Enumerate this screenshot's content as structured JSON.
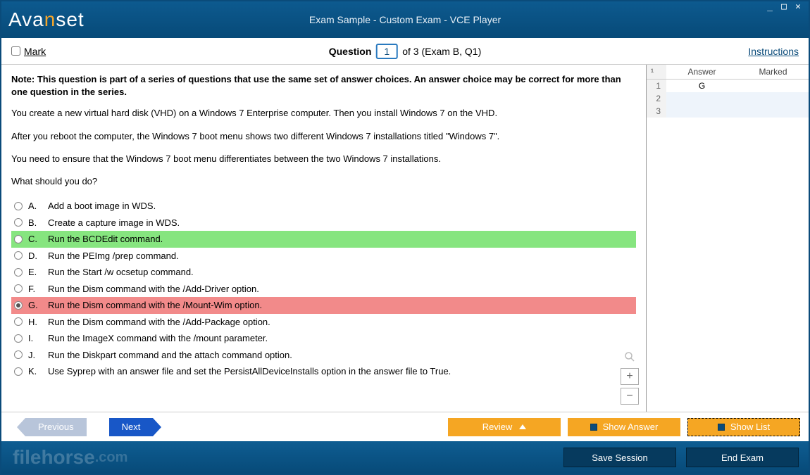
{
  "header": {
    "logo_pre": "Ava",
    "logo_n": "n",
    "logo_post": "set",
    "title": "Exam Sample - Custom Exam - VCE Player"
  },
  "qbar": {
    "mark_label": "Mark",
    "question_label": "Question",
    "number": "1",
    "of_text": "of 3 (Exam B, Q1)",
    "instructions": "Instructions"
  },
  "question": {
    "note": "Note: This question is part of a series of questions that use the same set of answer choices. An answer choice may be correct for more than one question in the series.",
    "p1": "You create a new virtual hard disk (VHD) on a Windows 7 Enterprise computer. Then you install Windows 7 on the VHD.",
    "p2": "After you reboot the computer, the Windows 7 boot menu shows two different Windows 7 installations titled \"Windows 7\".",
    "p3": "You need to ensure that the Windows 7 boot menu differentiates between the two Windows 7 installations.",
    "p4": "What should you do?",
    "choices": [
      {
        "l": "A.",
        "t": "Add a boot image in WDS."
      },
      {
        "l": "B.",
        "t": "Create a capture image in WDS."
      },
      {
        "l": "C.",
        "t": "Run the BCDEdit command."
      },
      {
        "l": "D.",
        "t": "Run the PEImg /prep command."
      },
      {
        "l": "E.",
        "t": "Run the Start /w ocsetup command."
      },
      {
        "l": "F.",
        "t": "Run the Dism command with the /Add-Driver option."
      },
      {
        "l": "G.",
        "t": "Run the Dism command with the /Mount-Wim option."
      },
      {
        "l": "H.",
        "t": "Run the Dism command with the /Add-Package option."
      },
      {
        "l": "I.",
        "t": "Run the ImageX command with the /mount parameter."
      },
      {
        "l": "J.",
        "t": "Run the Diskpart command and the attach command option."
      },
      {
        "l": "K.",
        "t": "Use Syprep with an answer file and set the PersistAllDeviceInstalls option in the answer file to True."
      }
    ]
  },
  "side": {
    "h_num": "¹",
    "h_ans": "Answer",
    "h_mark": "Marked",
    "rows": [
      {
        "n": "1",
        "a": "G",
        "m": ""
      },
      {
        "n": "2",
        "a": "",
        "m": ""
      },
      {
        "n": "3",
        "a": "",
        "m": ""
      }
    ]
  },
  "buttons": {
    "prev": "Previous",
    "next": "Next",
    "review": "Review",
    "show_answer": "Show Answer",
    "show_list": "Show List",
    "save": "Save Session",
    "end": "End Exam"
  },
  "watermark": {
    "a": "filehorse",
    "b": ".com"
  }
}
